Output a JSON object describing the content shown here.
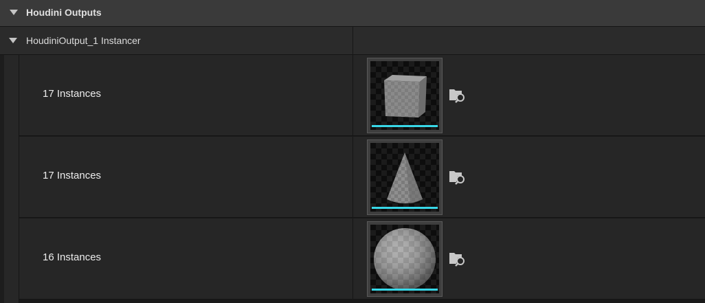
{
  "category": {
    "title": "Houdini Outputs",
    "chevron_icon": "chevron-down-icon"
  },
  "group": {
    "title": "HoudiniOutput_1 Instancer",
    "chevron_icon": "chevron-down-icon"
  },
  "colors": {
    "accent": "#38d8e8"
  },
  "instances": [
    {
      "label": "17 Instances",
      "mesh_icon": "cube-mesh-thumbnail",
      "browse_icon": "browse-asset-icon"
    },
    {
      "label": "17 Instances",
      "mesh_icon": "cone-mesh-thumbnail",
      "browse_icon": "browse-asset-icon"
    },
    {
      "label": "16 Instances",
      "mesh_icon": "sphere-mesh-thumbnail",
      "browse_icon": "browse-asset-icon"
    }
  ]
}
